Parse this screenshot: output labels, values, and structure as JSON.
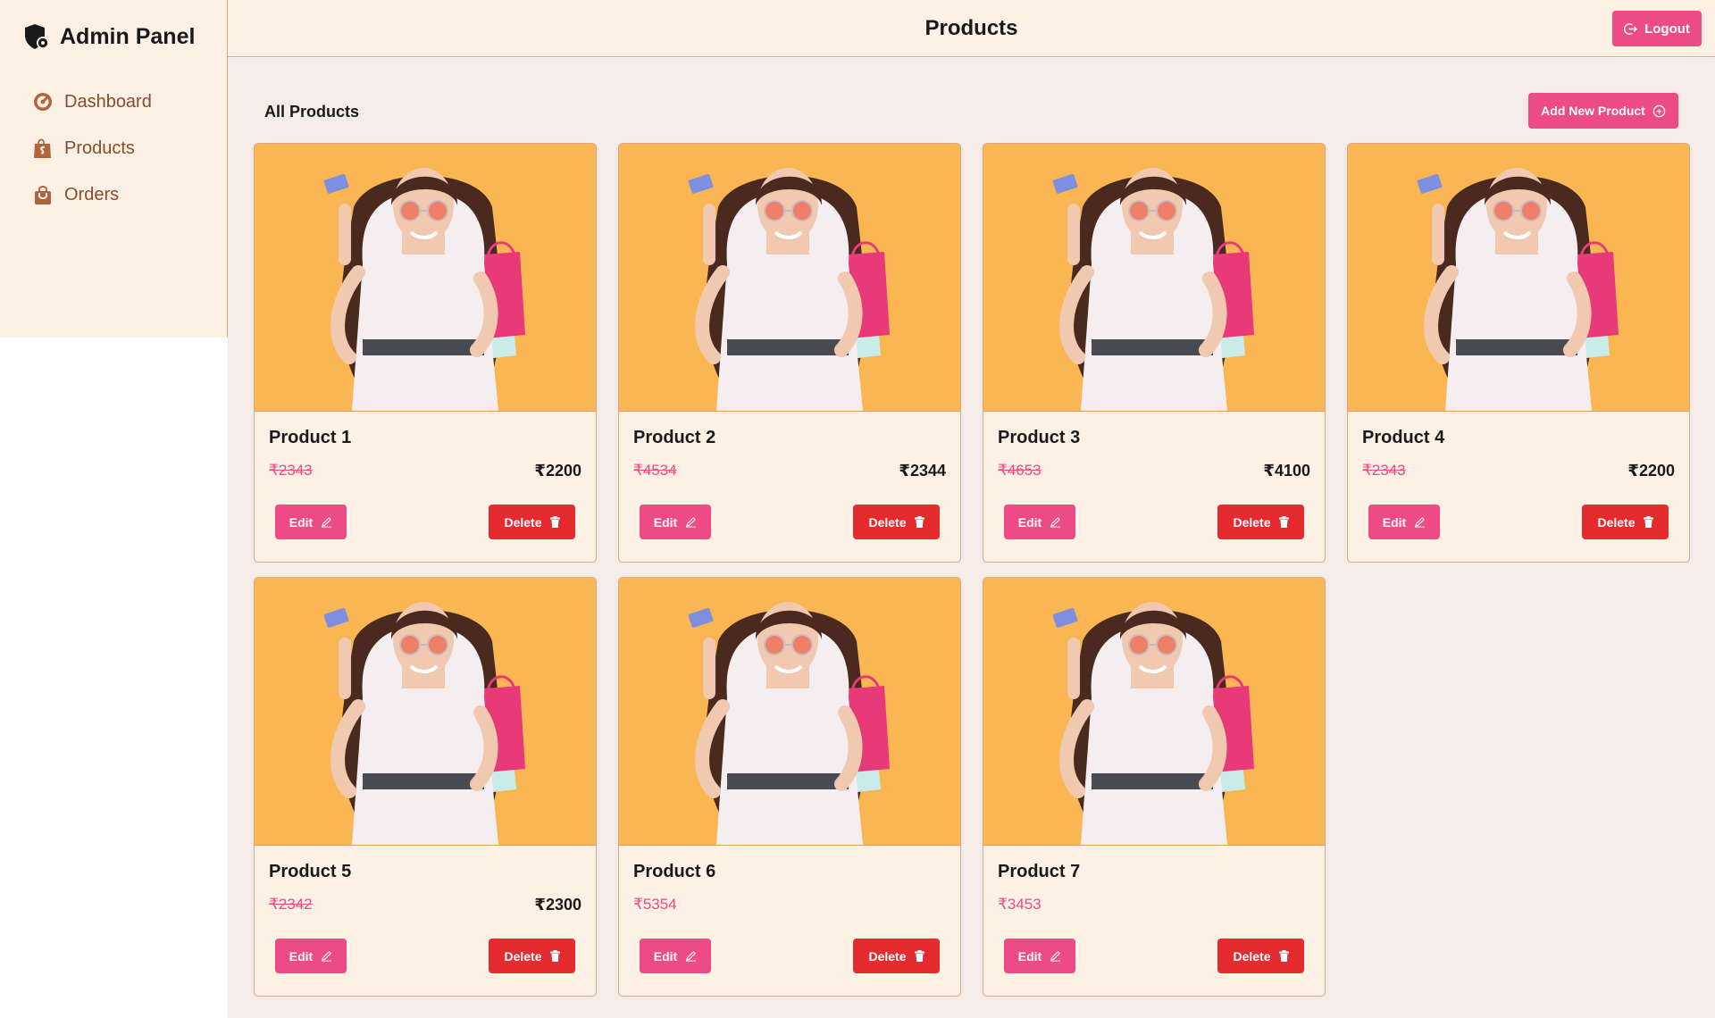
{
  "sidebar": {
    "brand_title": "Admin Panel",
    "brand_icon": "shield-gear-icon",
    "items": [
      {
        "label": "Dashboard",
        "icon": "gauge-icon"
      },
      {
        "label": "Products",
        "icon": "shopping-bag-icon"
      },
      {
        "label": "Orders",
        "icon": "shopping-basket-icon"
      }
    ]
  },
  "header": {
    "title": "Products",
    "logout_label": "Logout",
    "logout_icon": "logout-icon"
  },
  "main": {
    "section_title": "All Products",
    "add_label": "Add New Product",
    "add_icon": "plus-circle-icon"
  },
  "products": [
    {
      "name": "Product 1",
      "price": "₹2343",
      "sale_price": "₹2200"
    },
    {
      "name": "Product 2",
      "price": "₹4534",
      "sale_price": "₹2344"
    },
    {
      "name": "Product 3",
      "price": "₹4653",
      "sale_price": "₹4100"
    },
    {
      "name": "Product 4",
      "price": "₹2343",
      "sale_price": "₹2200"
    },
    {
      "name": "Product 5",
      "price": "₹2342",
      "sale_price": "₹2300"
    },
    {
      "name": "Product 6",
      "price": "₹5354",
      "sale_price": ""
    },
    {
      "name": "Product 7",
      "price": "₹3453",
      "sale_price": ""
    }
  ],
  "card_actions": {
    "edit_label": "Edit",
    "delete_label": "Delete"
  },
  "colors": {
    "accent": "#ec4b86",
    "danger": "#e42b30",
    "panel": "#fdf0e4",
    "main_bg": "#f5ebe7",
    "image_bg": "#fab653",
    "nav_text": "#8a4a2c"
  }
}
